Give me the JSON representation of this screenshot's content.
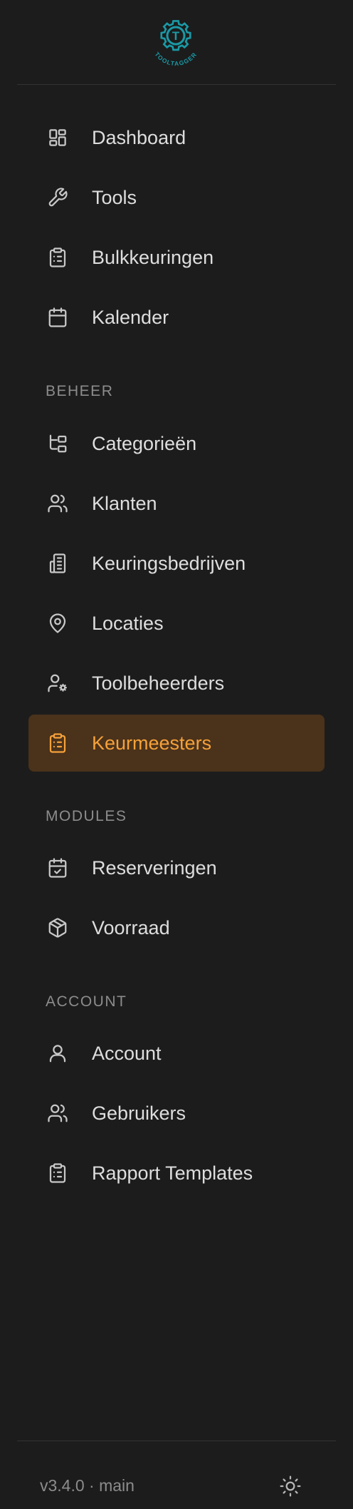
{
  "brand": {
    "name": "TOOLTAGGER",
    "logo_letter": "T",
    "logo_color": "#1a9aa6"
  },
  "nav": {
    "main": [
      {
        "label": "Dashboard",
        "icon": "dashboard-icon"
      },
      {
        "label": "Tools",
        "icon": "wrench-icon"
      },
      {
        "label": "Bulkkeuringen",
        "icon": "clipboard-list-icon"
      },
      {
        "label": "Kalender",
        "icon": "calendar-icon"
      }
    ],
    "beheer": {
      "header": "BEHEER",
      "items": [
        {
          "label": "Categorieën",
          "icon": "category-tree-icon"
        },
        {
          "label": "Klanten",
          "icon": "users-icon"
        },
        {
          "label": "Keuringsbedrijven",
          "icon": "building-icon"
        },
        {
          "label": "Locaties",
          "icon": "map-pin-icon"
        },
        {
          "label": "Toolbeheerders",
          "icon": "user-cog-icon"
        },
        {
          "label": "Keurmeesters",
          "icon": "clipboard-list-icon",
          "active": true
        }
      ]
    },
    "modules": {
      "header": "MODULES",
      "items": [
        {
          "label": "Reserveringen",
          "icon": "calendar-check-icon"
        },
        {
          "label": "Voorraad",
          "icon": "package-icon"
        }
      ]
    },
    "account": {
      "header": "ACCOUNT",
      "items": [
        {
          "label": "Account",
          "icon": "user-icon"
        },
        {
          "label": "Gebruikers",
          "icon": "users-icon"
        },
        {
          "label": "Rapport Templates",
          "icon": "clipboard-list-icon"
        }
      ]
    }
  },
  "footer": {
    "version": "v3.4.0 · main",
    "theme_toggle_icon": "sun-icon"
  },
  "colors": {
    "background": "#1c1c1c",
    "active_bg": "#4a321b",
    "active_fg": "#f5a13a",
    "text": "#dedede",
    "muted": "#8c8c8c"
  }
}
